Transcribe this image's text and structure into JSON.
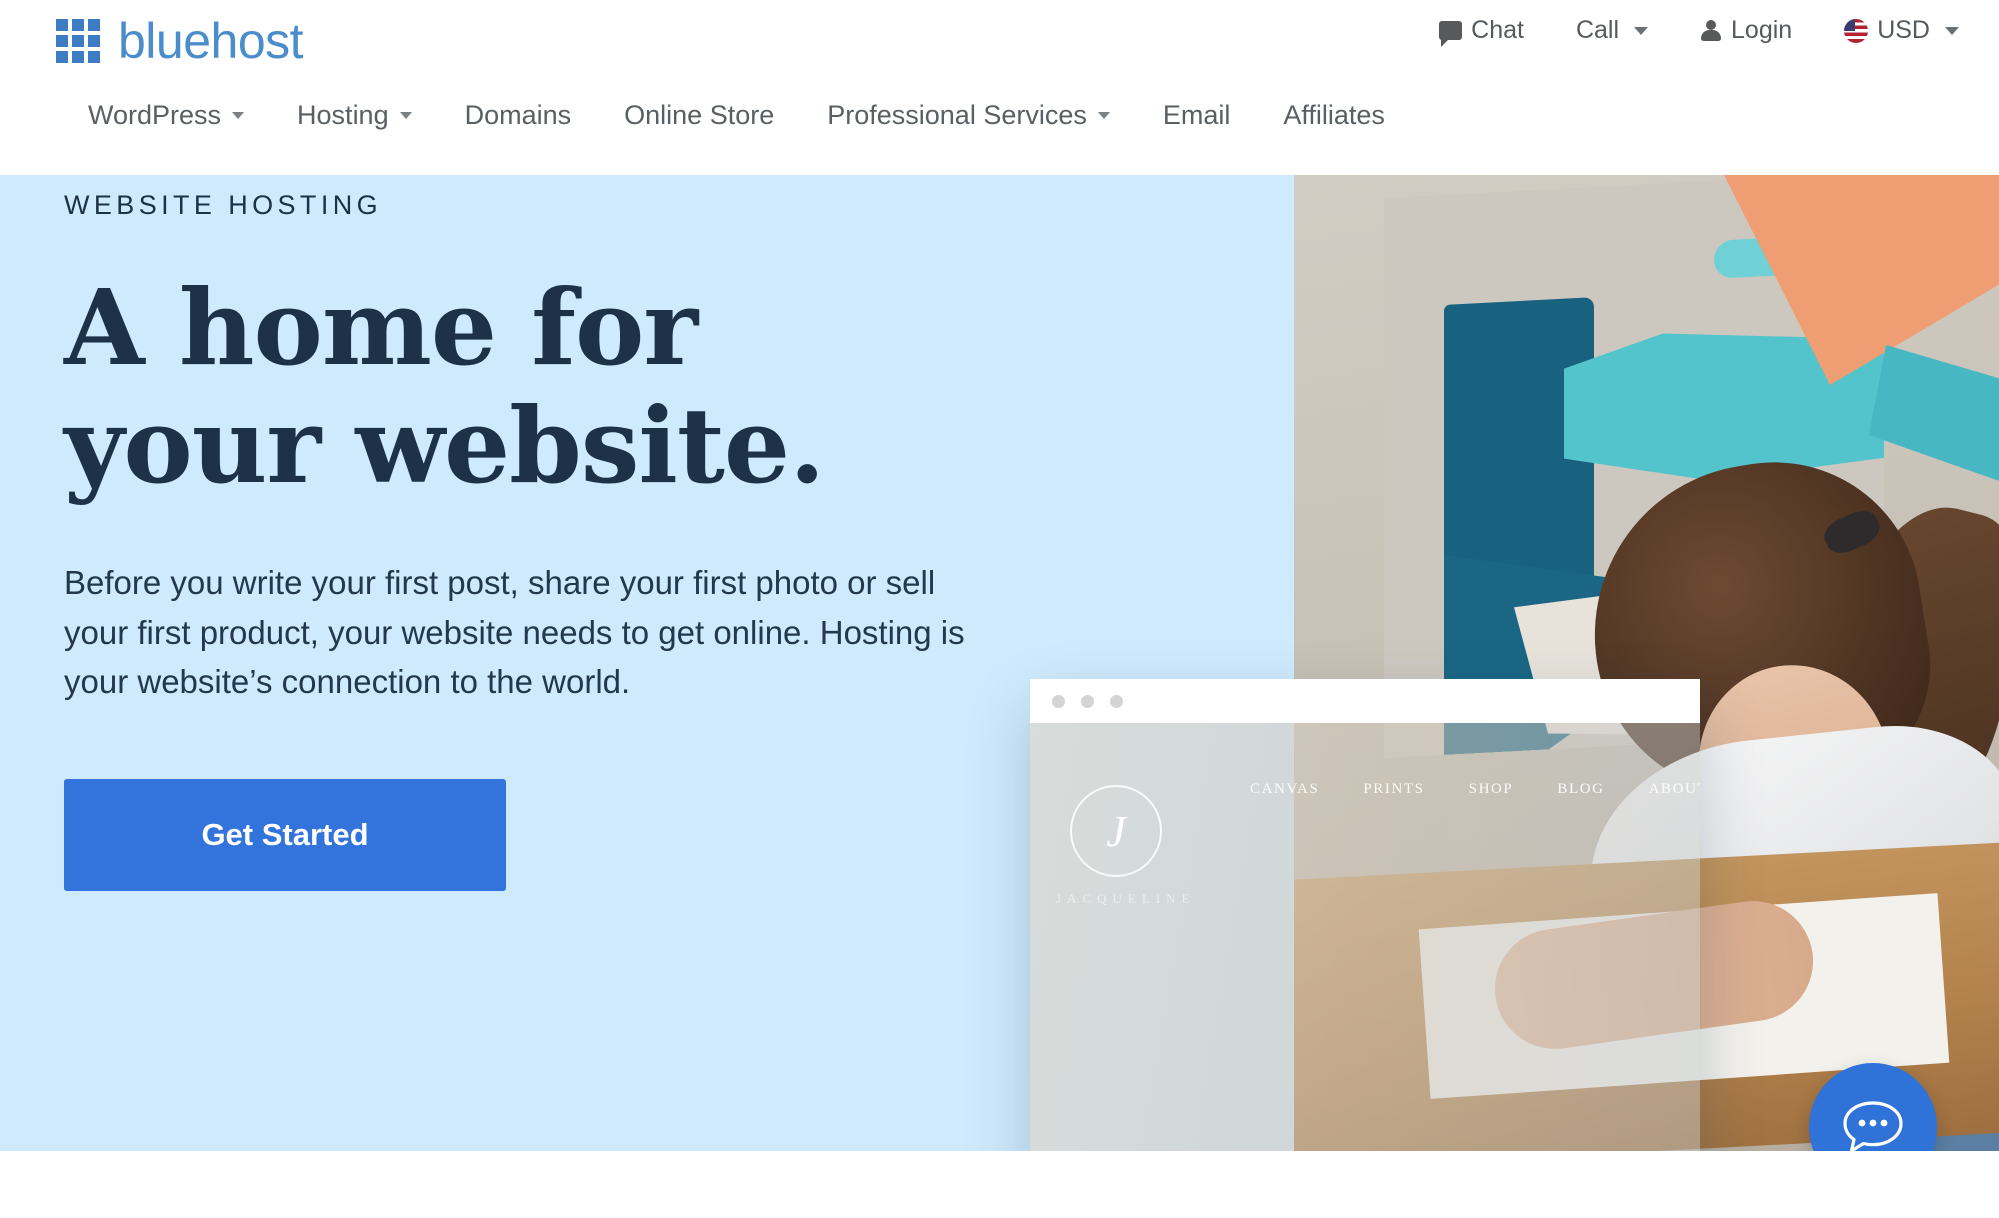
{
  "brand": {
    "name": "bluehost",
    "logo_icon": "grid-squares-icon",
    "logo_color": "#3c7cc3",
    "wordmark_color": "#4b8ccb"
  },
  "utility_nav": {
    "items": [
      {
        "label": "Chat",
        "icon": "chat-bubble-icon",
        "has_caret": false
      },
      {
        "label": "Call",
        "icon": "",
        "has_caret": true
      },
      {
        "label": "Login",
        "icon": "person-icon",
        "has_caret": false
      },
      {
        "label": "USD",
        "icon": "us-flag-icon",
        "has_caret": true
      }
    ]
  },
  "main_nav": {
    "items": [
      {
        "label": "WordPress",
        "has_caret": true
      },
      {
        "label": "Hosting",
        "has_caret": true
      },
      {
        "label": "Domains",
        "has_caret": false
      },
      {
        "label": "Online Store",
        "has_caret": false
      },
      {
        "label": "Professional Services",
        "has_caret": true
      },
      {
        "label": "Email",
        "has_caret": false
      },
      {
        "label": "Affiliates",
        "has_caret": false
      }
    ]
  },
  "hero": {
    "background_color": "#cfeafc",
    "eyebrow": "WEBSITE HOSTING",
    "headline_line1": "A home for",
    "headline_line2": "your website.",
    "subcopy": "Before you write your first post, share your first photo or sell your first product, your website needs to get online. Hosting is your website’s connection to the world.",
    "cta_label": "Get Started",
    "cta_color": "#3273dc",
    "headline_color": "#1d3149"
  },
  "browser_mockup": {
    "window_dots": 3,
    "logo_letter": "J",
    "brand_text": "JACQUELINE",
    "nav_items": [
      "CANVAS",
      "PRINTS",
      "SHOP",
      "BLOG",
      "ABOUT ME"
    ]
  },
  "chat_widget": {
    "icon": "chat-bubble-dots-icon",
    "color": "#2f72d8"
  }
}
